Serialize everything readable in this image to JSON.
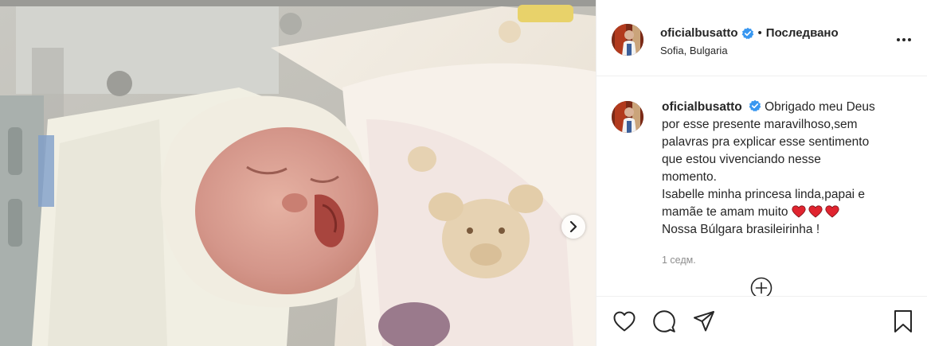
{
  "post": {
    "username": "oficialbusatto",
    "follow_separator": "•",
    "follow_status": "Последвано",
    "location": "Sofia, Bulgaria",
    "caption_lines": [
      "Obrigado meu Deus",
      "por esse presente maravilhoso,sem",
      "palavras pra explicar esse sentimento",
      "que estou vivenciando nesse",
      "momento.",
      "Isabelle minha princesa linda,papai e",
      "mamãe te amam muito",
      "Nossa Búlgara brasileirinha !"
    ],
    "timestamp": "1 седм."
  },
  "icons": {
    "verified": "verified-badge-icon",
    "more": "more-options-icon",
    "heart_emoji": "red-heart-icon",
    "next": "chevron-right-icon",
    "load_more": "plus-circle-icon",
    "like": "heart-icon",
    "comment": "comment-icon",
    "share": "paper-plane-icon",
    "save": "bookmark-icon"
  },
  "colors": {
    "verified_blue": "#3897f0",
    "text": "#262626",
    "muted": "#8e8e8e",
    "heart_red": "#e0242f",
    "border": "#efefef"
  }
}
